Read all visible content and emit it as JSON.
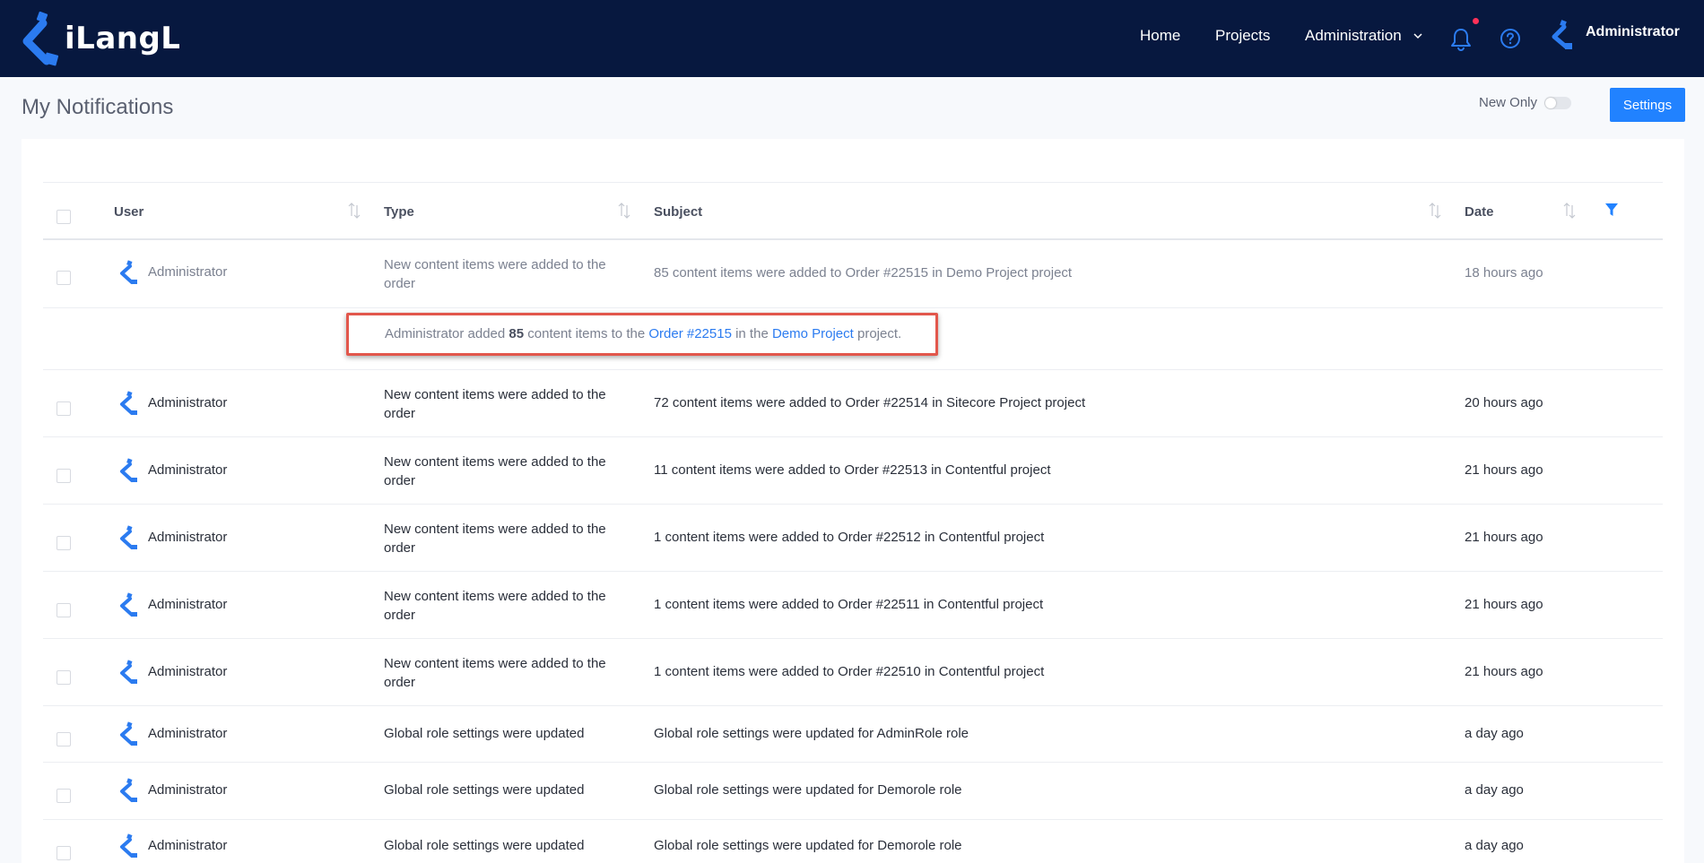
{
  "app": {
    "logo_text": "iLangL",
    "nav": {
      "home": "Home",
      "projects": "Projects",
      "administration": "Administration"
    },
    "current_user": "Administrator",
    "colors": {
      "nav_bg": "#07183f",
      "accent": "#2182ff",
      "highlight_border": "#e2574c",
      "notification_dot": "#ff3158"
    }
  },
  "page": {
    "title": "My Notifications",
    "new_only_label": "New Only",
    "new_only_enabled": false,
    "settings_label": "Settings"
  },
  "table": {
    "columns": {
      "user": "User",
      "type": "Type",
      "subject": "Subject",
      "date": "Date"
    },
    "rows": [
      {
        "user": "Administrator",
        "type": "New content items were added to the order",
        "subject": "85 content items were added to Order #22515 in Demo Project project",
        "date": "18 hours ago",
        "read": true
      },
      {
        "user": "Administrator",
        "type": "New content items were added to the order",
        "subject": "72 content items were added to Order #22514 in Sitecore Project project",
        "date": "20 hours ago",
        "read": false
      },
      {
        "user": "Administrator",
        "type": "New content items were added to the order",
        "subject": "11 content items were added to Order #22513 in Contentful project",
        "date": "21 hours ago",
        "read": false
      },
      {
        "user": "Administrator",
        "type": "New content items were added to the order",
        "subject": "1 content items were added to Order #22512 in Contentful project",
        "date": "21 hours ago",
        "read": false
      },
      {
        "user": "Administrator",
        "type": "New content items were added to the order",
        "subject": "1 content items were added to Order #22511 in Contentful project",
        "date": "21 hours ago",
        "read": false
      },
      {
        "user": "Administrator",
        "type": "New content items were added to the order",
        "subject": "1 content items were added to Order #22510 in Contentful project",
        "date": "21 hours ago",
        "read": false
      },
      {
        "user": "Administrator",
        "type": "Global role settings were updated",
        "subject": "Global role settings were updated for AdminRole role",
        "date": "a day ago",
        "read": false
      },
      {
        "user": "Administrator",
        "type": "Global role settings were updated",
        "subject": "Global role settings were updated for Demorole role",
        "date": "a day ago",
        "read": false
      },
      {
        "user": "Administrator",
        "type": "Global role settings were updated",
        "subject": "Global role settings were updated for Demorole role",
        "date": "a day ago",
        "read": false
      }
    ],
    "expanded_detail": {
      "prefix": "Administrator added ",
      "count": "85",
      "middle": " content items to the ",
      "order_link": "Order #22515",
      "in_the": " in the ",
      "project_link": "Demo Project",
      "suffix": " project."
    }
  },
  "icons": {
    "logo": "ilangl-logo-icon",
    "bell": "bell-icon",
    "help": "help-circle-icon",
    "chevron": "chevron-down-icon",
    "sort": "sort-arrows-icon",
    "filter": "filter-icon",
    "avatar": "ilangl-avatar-icon"
  }
}
